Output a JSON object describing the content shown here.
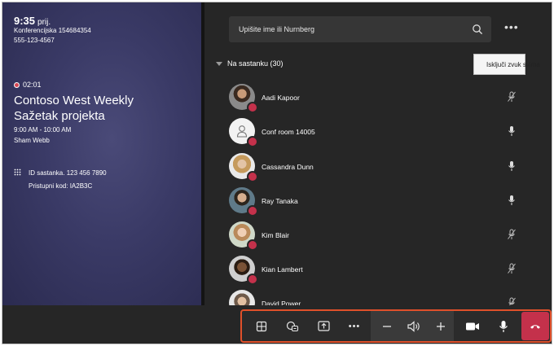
{
  "meeting": {
    "time": "9:35",
    "ampm": "prij.",
    "conference_line": "Konferencijska 154684354",
    "phone": "555-123-4567",
    "recording_time": "02:01",
    "title_line1": "Contoso West Weekly",
    "title_line2": "Sažetak projekta",
    "time_range_start": "9:00",
    "time_range_rest": "AM - 10:00 AM",
    "organizer": "Sham Webb",
    "meeting_id": "ID sastanka. 123 456 7890",
    "access_code": "Pristupni kod: IA2B3C"
  },
  "participants_panel": {
    "search_placeholder": "Upišite ime ili Nurnberg",
    "section_label": "Na sastanku (30)",
    "mute_all_label": "Isključi zvuk svima",
    "people": [
      {
        "name": "Aadi Kapoor",
        "avatar": "photo",
        "mic": "muted"
      },
      {
        "name": "Conf room 14005",
        "avatar": "room",
        "mic": "on"
      },
      {
        "name": "Cassandra Dunn",
        "avatar": "photo",
        "mic": "on"
      },
      {
        "name": "Ray Tanaka",
        "avatar": "photo",
        "mic": "on"
      },
      {
        "name": "Kim Blair",
        "avatar": "photo",
        "mic": "muted"
      },
      {
        "name": "Kian Lambert",
        "avatar": "photo",
        "mic": "muted"
      },
      {
        "name": "David Power",
        "avatar": "photo",
        "mic": "muted"
      }
    ]
  },
  "toolbar": {
    "icons": [
      "grid-view-icon",
      "participants-chat-icon",
      "share-screen-icon",
      "more-icon",
      "volume-down-icon",
      "speaker-icon",
      "volume-up-icon",
      "camera-icon",
      "microphone-icon",
      "hang-up-icon"
    ]
  },
  "colors": {
    "accent_presence": "#c4314b",
    "hangup": "#c4314b",
    "toolbar_outline": "#e0502a",
    "left_panel": "#3a3a66"
  }
}
